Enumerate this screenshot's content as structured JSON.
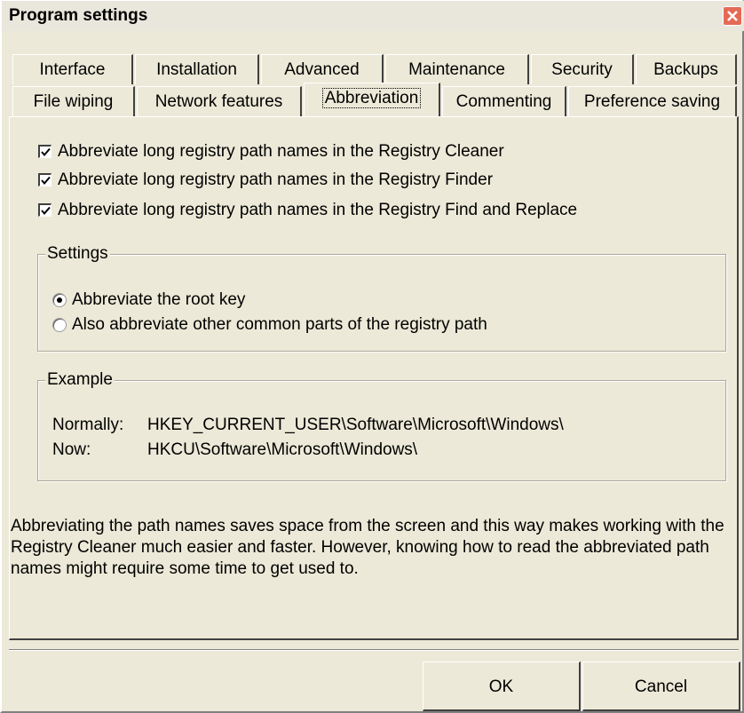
{
  "window": {
    "title": "Program settings"
  },
  "tabs": {
    "row1": [
      "Interface",
      "Installation",
      "Advanced",
      "Maintenance",
      "Security",
      "Backups"
    ],
    "row2": [
      "File wiping",
      "Network features",
      "Abbreviation",
      "Commenting",
      "Preference saving"
    ],
    "active": "Abbreviation"
  },
  "checkboxes": [
    {
      "label": "Abbreviate long registry path names in the Registry Cleaner",
      "checked": true
    },
    {
      "label": "Abbreviate long registry path names in the Registry Finder",
      "checked": true
    },
    {
      "label": "Abbreviate long registry path names in the Registry Find and Replace",
      "checked": true
    }
  ],
  "settings": {
    "title": "Settings",
    "options": [
      {
        "label": "Abbreviate the root key",
        "selected": true
      },
      {
        "label": "Also abbreviate other common parts of the registry path",
        "selected": false
      }
    ]
  },
  "example": {
    "title": "Example",
    "normally_label": "Normally:",
    "normally_value": "HKEY_CURRENT_USER\\Software\\Microsoft\\Windows\\",
    "now_label": "Now:",
    "now_value": "HKCU\\Software\\Microsoft\\Windows\\"
  },
  "description": "Abbreviating the path names saves space from the screen and this way makes working with the Registry Cleaner much easier and faster. However, knowing how to read the abbreviated path names might require some time to get used to.",
  "buttons": {
    "ok": "OK",
    "cancel": "Cancel"
  }
}
